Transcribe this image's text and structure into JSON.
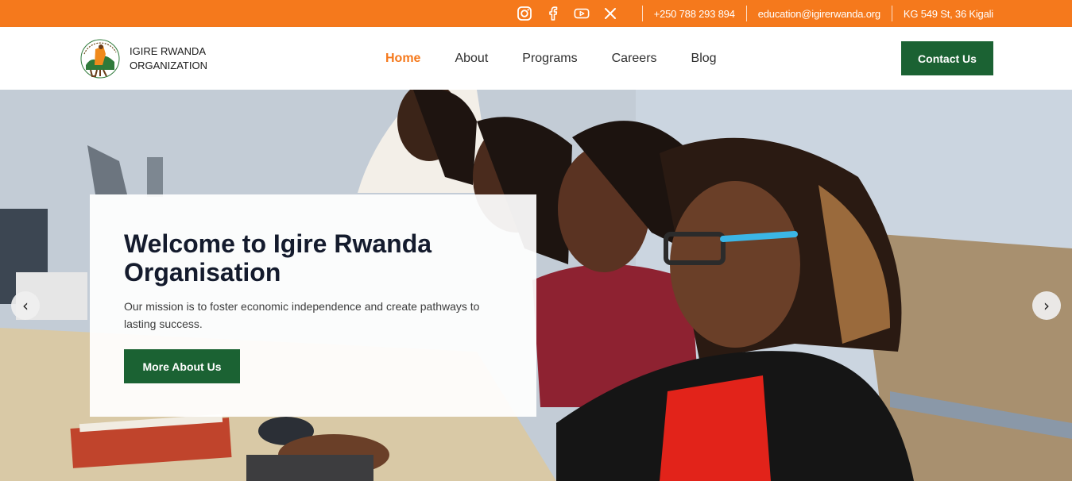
{
  "topbar": {
    "social": [
      {
        "icon": "instagram-icon"
      },
      {
        "icon": "facebook-icon"
      },
      {
        "icon": "youtube-icon"
      },
      {
        "icon": "x-twitter-icon"
      }
    ],
    "phone": "+250 788 293 894",
    "email": "education@igirerwanda.org",
    "address": "KG 549 St, 36 Kigali",
    "color": "#f5791c"
  },
  "header": {
    "logo_line1": "IGIRE RWANDA",
    "logo_line2": "ORGANIZATION",
    "nav": [
      "Home",
      "About",
      "Programs",
      "Careers",
      "Blog"
    ],
    "active_nav": "Home",
    "contact_label": "Contact Us",
    "accent": "#1b6233"
  },
  "hero": {
    "title": "Welcome to Igire Rwanda Organisation",
    "subtitle": "Our mission is to foster economic independence and create pathways to lasting success.",
    "button_label": "More About Us",
    "prev_icon": "chevron-left-icon",
    "next_icon": "chevron-right-icon",
    "prev_glyph": "‹",
    "next_glyph": "›"
  }
}
